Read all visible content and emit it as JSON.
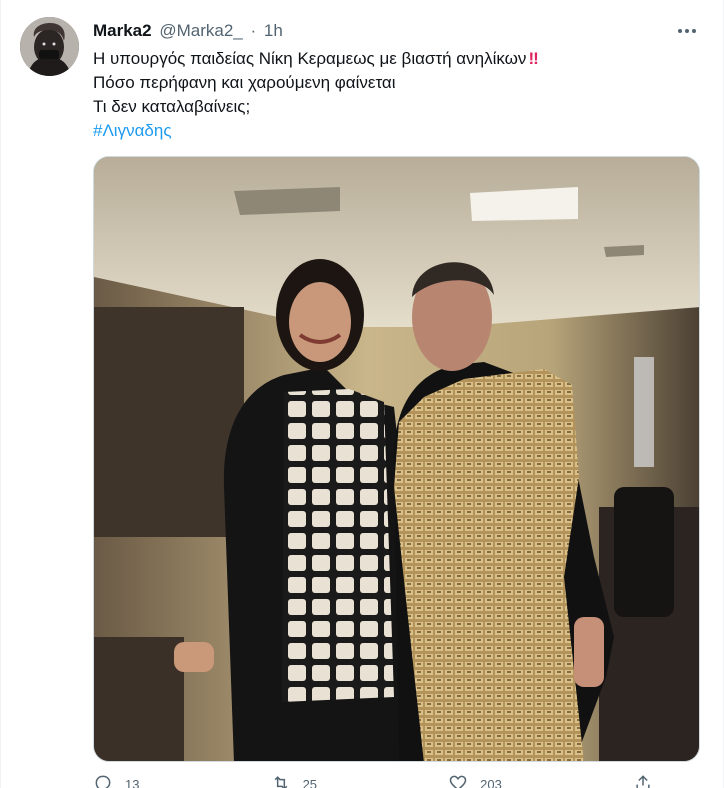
{
  "tweet": {
    "author": {
      "display_name": "Marka2",
      "handle": "@Marka2_",
      "separator": "·",
      "time": "1h"
    },
    "text_lines": [
      "Η υπουργός παιδείας Νίκη Κεραμεως με βιαστή ανηλίκων",
      "Πόσο περήφανη και χαρούμενη φαίνεται",
      "Τι δεν καταλαβαίνεις;"
    ],
    "emphasis_emoji": "‼",
    "hashtag": "#Λιγναδης",
    "actions": {
      "reply_count": "13",
      "retweet_count": "25",
      "like_count": "203"
    }
  },
  "icons": {
    "more": "more-horizontal-icon",
    "reply": "reply-icon",
    "retweet": "retweet-icon",
    "like": "heart-icon",
    "share": "share-icon"
  },
  "colors": {
    "accent": "#1d9bf0",
    "text": "#0f1419",
    "secondary": "#536471",
    "emoji_red": "#e0245e"
  }
}
